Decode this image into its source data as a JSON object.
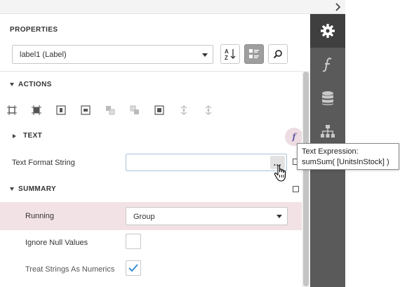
{
  "panel": {
    "title": "PROPERTIES",
    "component_selector": {
      "value": "label1 (Label)"
    },
    "toolbar": {
      "sort_alpha_icon": "sort-alphabetical-icon",
      "categorized_icon": "categorized-view-icon",
      "search_icon": "search-icon"
    }
  },
  "groups": {
    "actions": {
      "label": "ACTIONS",
      "expanded": true
    },
    "text": {
      "label": "TEXT",
      "expanded": false
    },
    "summary": {
      "label": "SUMMARY",
      "expanded": true
    }
  },
  "properties": {
    "text_format_string": {
      "label": "Text Format String",
      "value": "",
      "editor_button": "..."
    },
    "running": {
      "label": "Running",
      "value": "Group"
    },
    "ignore_null_values": {
      "label": "Ignore Null Values",
      "checked": false
    },
    "treat_strings_as_numerics": {
      "label": "Treat Strings As Numerics",
      "checked": true
    }
  },
  "expression_badge": {
    "glyph": "f"
  },
  "tooltip": {
    "line1": "Text Expression:",
    "line2": "sumSum( [UnitsInStock] )"
  },
  "sidebar": {
    "tabs": [
      {
        "icon": "gear-icon",
        "active": true
      },
      {
        "icon": "function-icon",
        "active": false
      },
      {
        "icon": "database-icon",
        "active": false
      },
      {
        "icon": "hierarchy-icon",
        "active": false
      }
    ]
  },
  "colors": {
    "sidebar_bg": "#5a5a5a",
    "sidebar_active": "#3f3f3f",
    "highlight_row": "#f3e2e5",
    "expression_accent": "#6a5ea8",
    "check_color": "#3d8fd1"
  }
}
